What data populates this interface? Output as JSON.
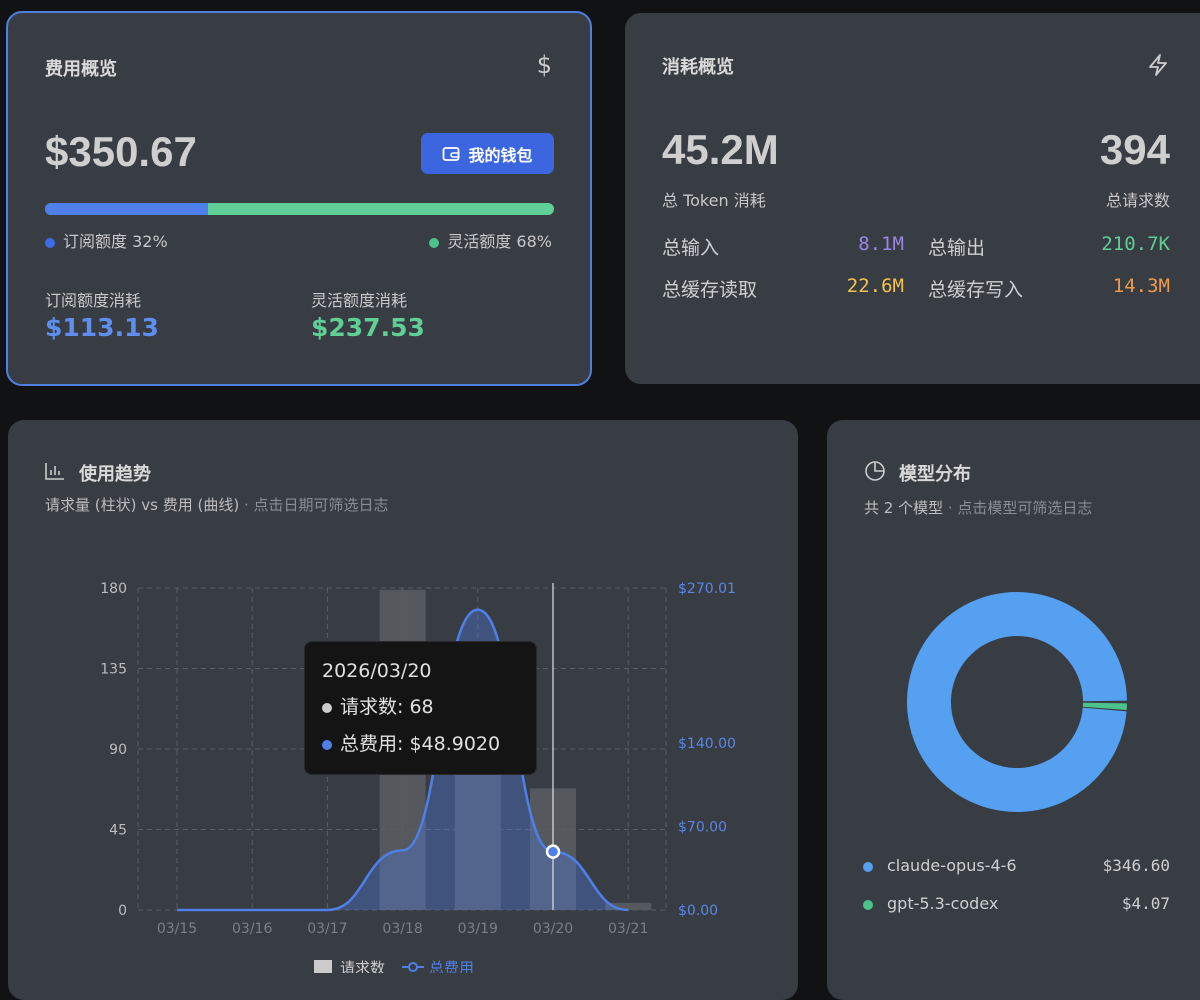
{
  "cost_card": {
    "title": "费用概览",
    "icon": "dollar-icon",
    "total": "$350.67",
    "wallet_button": "我的钱包",
    "subscription_pct": 32,
    "flex_pct": 68,
    "subscription_legend": "订阅额度 32%",
    "flex_legend": "灵活额度 68%",
    "subscription_used_label": "订阅额度消耗",
    "subscription_used_value": "$113.13",
    "flex_used_label": "灵活额度消耗",
    "flex_used_value": "$237.53",
    "colors": {
      "subscription": "#4f7fe8",
      "flex": "#5fcf95"
    }
  },
  "usage_card": {
    "title": "消耗概览",
    "icon": "lightning-icon",
    "tokens_value": "45.2M",
    "tokens_label": "总 Token 消耗",
    "requests_value": "394",
    "requests_label": "总请求数",
    "stats": [
      {
        "label": "总输入",
        "value": "8.1M",
        "color": "#9b86e8"
      },
      {
        "label": "总输出",
        "value": "210.7K",
        "color": "#5fcf95"
      },
      {
        "label": "总缓存读取",
        "value": "22.6M",
        "color": "#f2c14e"
      },
      {
        "label": "总缓存写入",
        "value": "14.3M",
        "color": "#ee9a4d"
      }
    ]
  },
  "trend_card": {
    "title": "使用趋势",
    "subtitle": "请求量 (柱状) vs 费用 (曲线)",
    "hint": "· 点击日期可筛选日志"
  },
  "model_card": {
    "title": "模型分布",
    "subtitle": "共 2 个模型",
    "hint": "· 点击模型可筛选日志"
  },
  "chart_data": [
    {
      "type": "bar+line",
      "categories": [
        "03/15",
        "03/16",
        "03/17",
        "03/18",
        "03/19",
        "03/20",
        "03/21"
      ],
      "series": [
        {
          "name": "请求数",
          "type": "bar",
          "axis": "left",
          "values": [
            0,
            0,
            0,
            179,
            143,
            68,
            4
          ],
          "color": "#5a5d62"
        },
        {
          "name": "总费用",
          "type": "line",
          "axis": "right",
          "values": [
            0,
            0,
            0,
            50.0,
            251.77,
            48.902,
            0
          ],
          "color": "#4f7fe8"
        }
      ],
      "left_ticks": [
        "0",
        "45",
        "90",
        "135",
        "180"
      ],
      "left_ylim": [
        0,
        180
      ],
      "right_ticks": [
        "$0.00",
        "$70.00",
        "$140.00",
        "$270.01"
      ],
      "right_tick_values": [
        0,
        70,
        140,
        270.01
      ],
      "right_ylim": [
        0,
        270.01
      ],
      "grid": true,
      "legend_position": "bottom",
      "tooltip": {
        "date": "2026/03/20",
        "requests_label": "请求数:",
        "requests_value": "68",
        "cost_label": "总费用:",
        "cost_value": "$48.9020"
      },
      "hover_index": 5
    },
    {
      "type": "pie",
      "slices": [
        {
          "name": "claude-opus-4-6",
          "value": 346.6,
          "label": "$346.60",
          "color": "#55a0f0"
        },
        {
          "name": "gpt-5.3-codex",
          "value": 4.07,
          "label": "$4.07",
          "color": "#4cc38a"
        }
      ]
    }
  ]
}
